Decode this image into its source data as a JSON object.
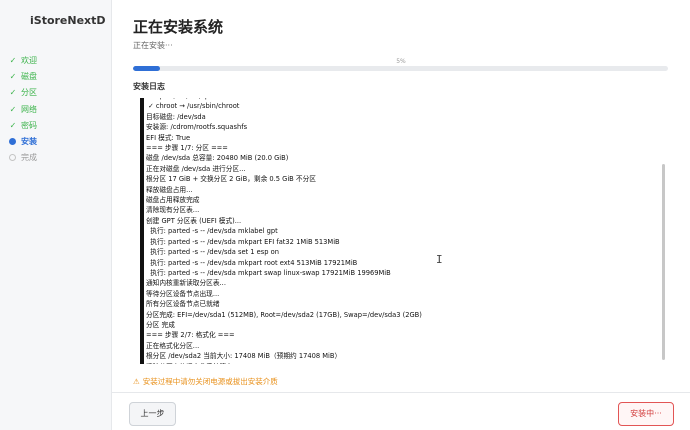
{
  "app": {
    "brand": "iStoreNextD"
  },
  "sidebar": {
    "steps": [
      {
        "label": "欢迎",
        "status": "done"
      },
      {
        "label": "磁盘",
        "status": "done"
      },
      {
        "label": "分区",
        "status": "done"
      },
      {
        "label": "网络",
        "status": "done"
      },
      {
        "label": "密码",
        "status": "done"
      },
      {
        "label": "安装",
        "status": "current"
      },
      {
        "label": "完成",
        "status": "pending"
      }
    ]
  },
  "main": {
    "title": "正在安装系统",
    "subtitle": "正在安装···",
    "progress": {
      "percent": 5,
      "label": "5%"
    },
    "log_title": "安装日志",
    "log_lines": [
      " ✓ cp → /usr/bin/cp",
      " ✓ chroot → /usr/sbin/chroot",
      "目标磁盘: /dev/sda",
      "安装源: /cdrom/rootfs.squashfs",
      "EFI 模式: True",
      "=== 步骤 1/7: 分区 ===",
      "磁盘 /dev/sda 总容量: 20480 MiB (20.0 GiB)",
      "正在对磁盘 /dev/sda 进行分区...",
      "根分区 17 GiB + 交换分区 2 GiB，剩余 0.5 GiB 不分区",
      "释放磁盘占用...",
      "磁盘占用释放完成",
      "清除现有分区表...",
      "创建 GPT 分区表 (UEFI 模式)...",
      "  执行: parted -s -- /dev/sda mklabel gpt",
      "  执行: parted -s -- /dev/sda mkpart EFI fat32 1MiB 513MiB",
      "  执行: parted -s -- /dev/sda set 1 esp on",
      "  执行: parted -s -- /dev/sda mkpart root ext4 513MiB 17921MiB",
      "  执行: parted -s -- /dev/sda mkpart swap linux-swap 17921MiB 19969MiB",
      "通知内核重新读取分区表...",
      "等待分区设备节点出现...",
      "所有分区设备节点已就绪",
      "分区完成: EFI=/dev/sda1 (512MB), Root=/dev/sda2 (17GB), Swap=/dev/sda3 (2GB)",
      "分区 完成",
      "=== 步骤 2/7: 格式化 ===",
      "正在格式化分区...",
      "根分区 /dev/sda2 当前大小: 17408 MiB（预期约 17408 MiB）",
      "清除分区上的旧文件系统签名...",
      "  清除 /dev/sda1 上的旧文件系统签名..."
    ],
    "warning": "安装过程中请勿关闭电源或拔出安装介质",
    "warning_icon": "⚠"
  },
  "footer": {
    "prev_label": "上一步",
    "install_label": "安装中···"
  },
  "colors": {
    "accent": "#2f6fd6",
    "done": "#3bb34a",
    "warning": "#e8901a",
    "danger": "#d23c3c"
  },
  "icons": {
    "done": "check-icon",
    "current": "dot-icon",
    "pending": "ring-icon",
    "warning": "warning-icon"
  }
}
